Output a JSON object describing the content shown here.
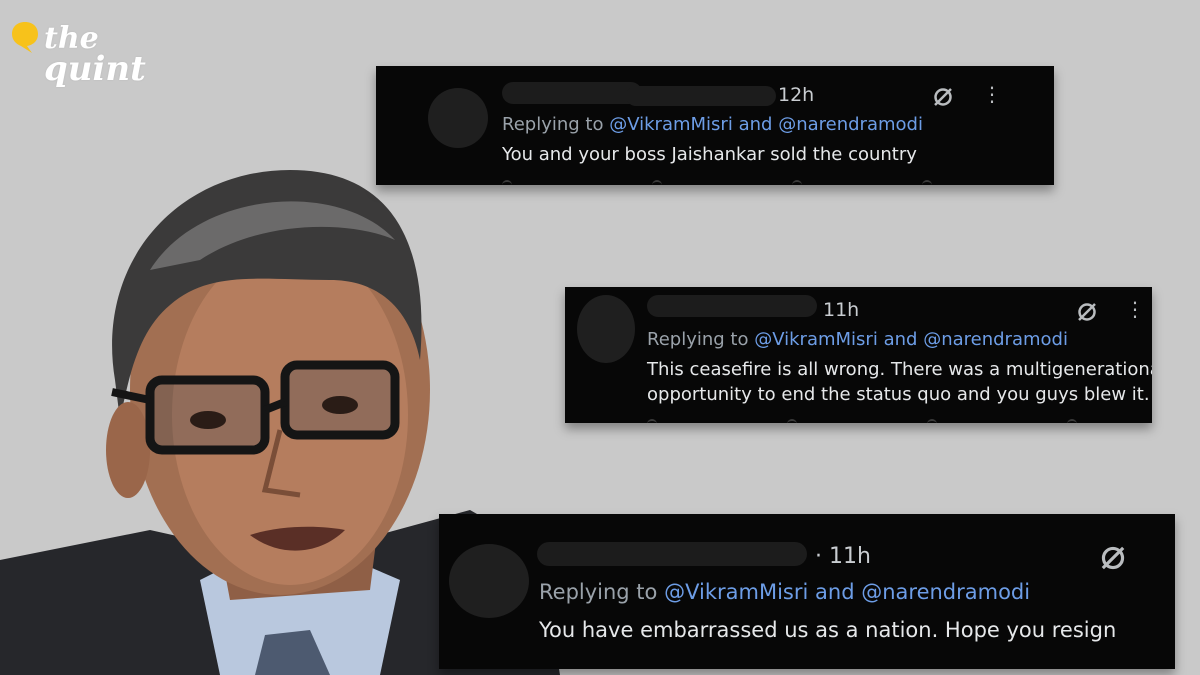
{
  "brand": {
    "logo_line1": "the",
    "logo_line2": "quint",
    "accent": "#f7c21b"
  },
  "tweets": [
    {
      "time": "12h",
      "reply_prefix": "Replying to",
      "mention1": "@VikramMisri",
      "and": "and",
      "mention2": "@narendramodi",
      "text": "You and your boss Jaishankar sold the country",
      "icons": [
        "mute-icon",
        "more-icon"
      ]
    },
    {
      "time": "11h",
      "reply_prefix": "Replying to",
      "mention1": "@VikramMisri",
      "and": "and",
      "mention2": "@narendramodi",
      "text_line1": "This ceasefire is all wrong. There was a multigenerational",
      "text_line2": "opportunity to end the status quo and you guys blew it.",
      "icons": [
        "mute-icon",
        "more-icon"
      ]
    },
    {
      "time": "· 11h",
      "reply_prefix": "Replying to",
      "mention1": "@VikramMisri",
      "and": "and",
      "mention2": "@narendramodi",
      "text": "You have embarrassed us as a nation. Hope you resign",
      "icons": [
        "mute-icon"
      ]
    }
  ]
}
